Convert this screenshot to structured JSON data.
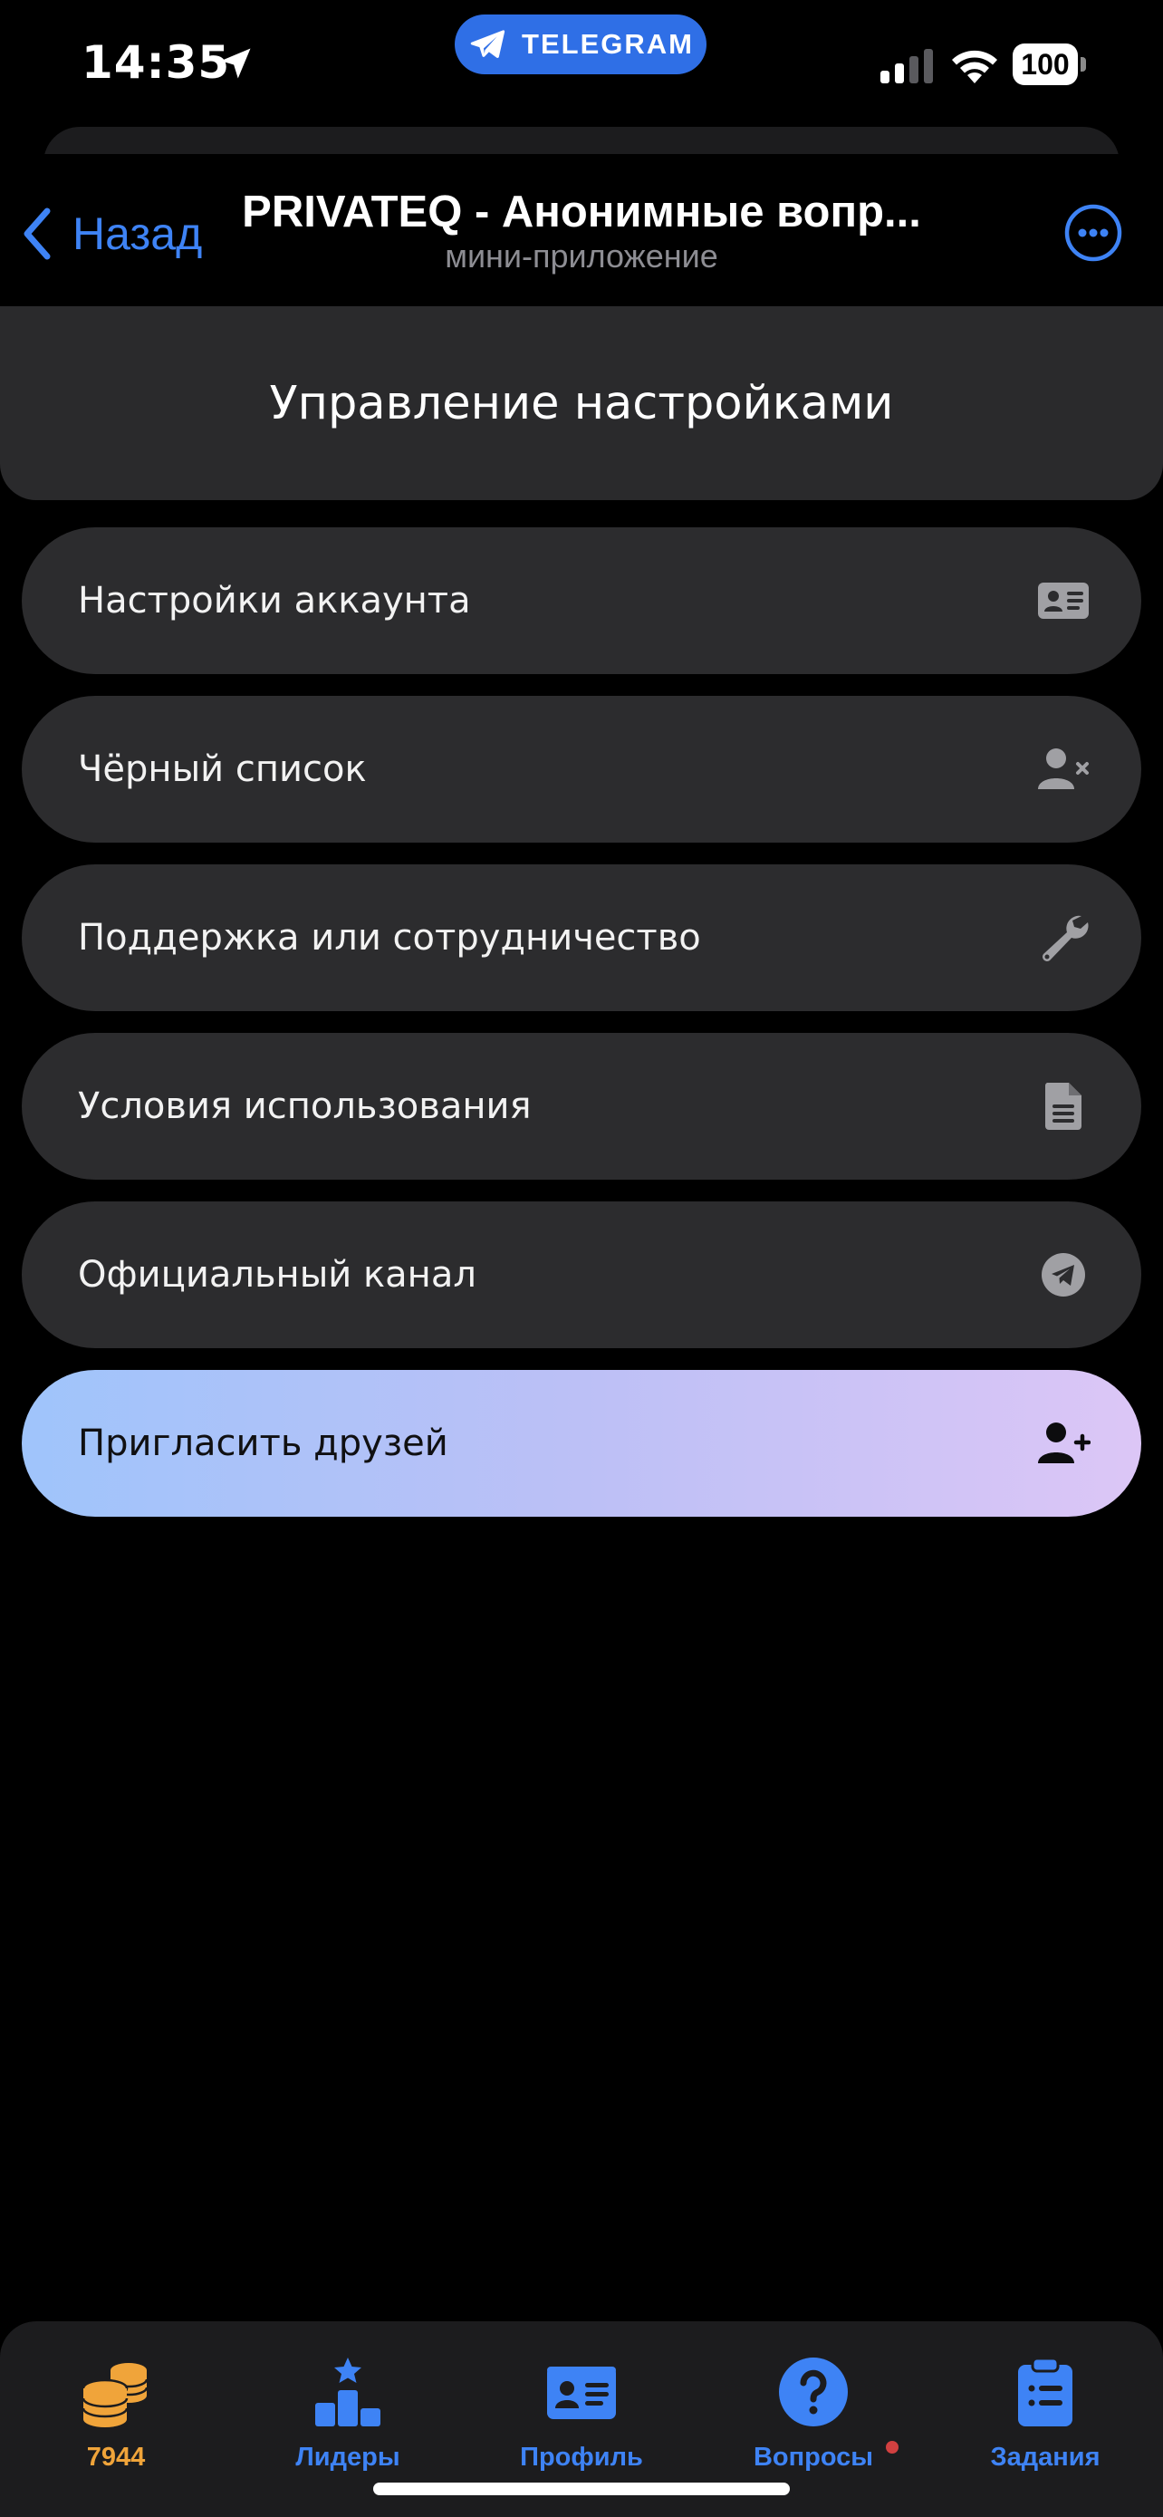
{
  "status_bar": {
    "time": "14:35",
    "telegram_badge": "TELEGRAM",
    "battery": "100"
  },
  "nav": {
    "back_label": "Назад",
    "title": "PRIVATEQ - Анонимные вопр...",
    "subtitle": "мини-приложение"
  },
  "header": {
    "title": "Управление настройками"
  },
  "menu": {
    "items": [
      {
        "label": "Настройки аккаунта",
        "icon": "id-card-icon"
      },
      {
        "label": "Чёрный список",
        "icon": "user-block-icon"
      },
      {
        "label": "Поддержка или сотрудничество",
        "icon": "wrench-icon"
      },
      {
        "label": "Условия использования",
        "icon": "document-icon"
      },
      {
        "label": "Официальный канал",
        "icon": "telegram-icon"
      },
      {
        "label": "Пригласить друзей",
        "icon": "user-plus-icon"
      }
    ]
  },
  "tabs": {
    "items": [
      {
        "label": "7944",
        "icon": "coins-icon"
      },
      {
        "label": "Лидеры",
        "icon": "leaderboard-icon"
      },
      {
        "label": "Профиль",
        "icon": "profile-card-icon"
      },
      {
        "label": "Вопросы",
        "icon": "question-icon"
      },
      {
        "label": "Задания",
        "icon": "tasks-clipboard-icon"
      }
    ]
  },
  "colors": {
    "accent": "#3e83f5",
    "coins": "#f0a43a",
    "card": "#2c2c2e",
    "invite_gradient_start": "#9fc4fb",
    "invite_gradient_end": "#dcc6f6"
  }
}
